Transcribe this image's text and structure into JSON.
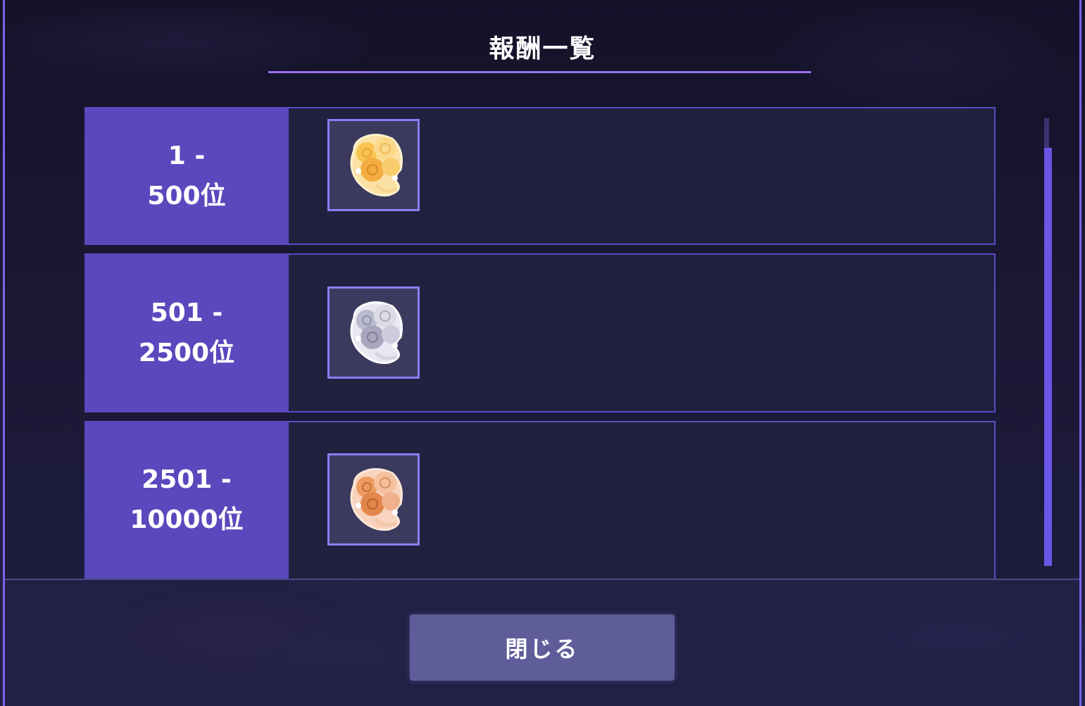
{
  "dialog": {
    "title": "報酬一覧",
    "close_label": "閉じる"
  },
  "rewards": [
    {
      "rank_line1": "1 -",
      "rank_line2": "500位",
      "item_icon": "gold-bouquet-icon",
      "item_color": "#f2b845"
    },
    {
      "rank_line1": "501 -",
      "rank_line2": "2500位",
      "item_icon": "silver-bouquet-icon",
      "item_color": "#c9c7d8"
    },
    {
      "rank_line1": "2501 -",
      "rank_line2": "10000位",
      "item_icon": "bronze-bouquet-icon",
      "item_color": "#eb9d6b"
    }
  ],
  "colors": {
    "accent": "#7d64e8",
    "rank_panel": "#5a48bd",
    "row_body": "#20213f",
    "button": "#5f5d99"
  }
}
